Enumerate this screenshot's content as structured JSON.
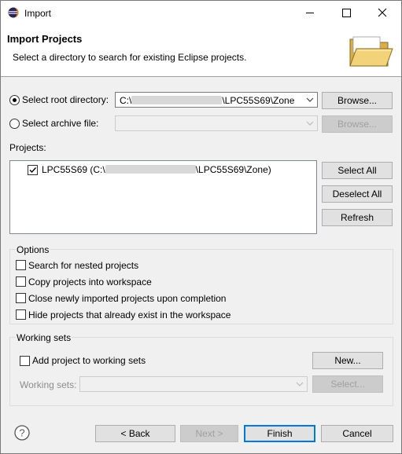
{
  "window": {
    "title": "Import"
  },
  "header": {
    "title": "Import Projects",
    "description": "Select a directory to search for existing Eclipse projects."
  },
  "source": {
    "root_label": "Select root directory:",
    "root_prefix": "C:\\",
    "root_suffix": "\\LPC55S69\\Zone",
    "archive_label": "Select archive file:",
    "browse_label": "Browse..."
  },
  "projects": {
    "label": "Projects:",
    "items": [
      {
        "prefix": "LPC55S69 (C:\\",
        "suffix": "\\LPC55S69\\Zone)",
        "checked": true
      }
    ],
    "select_all": "Select All",
    "deselect_all": "Deselect All",
    "refresh": "Refresh"
  },
  "options": {
    "title": "Options",
    "items": [
      "Search for nested projects",
      "Copy projects into workspace",
      "Close newly imported projects upon completion",
      "Hide projects that already exist in the workspace"
    ]
  },
  "working_sets": {
    "title": "Working sets",
    "add_label": "Add project to working sets",
    "new_label": "New...",
    "sets_label": "Working sets:",
    "select_label": "Select..."
  },
  "footer": {
    "back": "< Back",
    "next": "Next >",
    "finish": "Finish",
    "cancel": "Cancel"
  },
  "colors": {
    "accent": "#0078d7",
    "folder": "#e8c66a"
  }
}
